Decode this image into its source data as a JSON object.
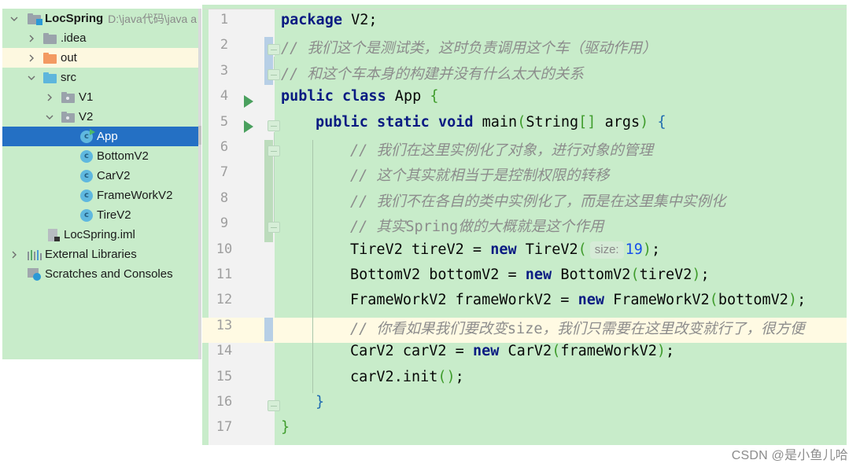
{
  "project_tree": {
    "root": {
      "name": "LocSpring",
      "path": "D:\\java代码\\java a"
    },
    "items": [
      {
        "label": ".idea",
        "type": "folder",
        "expanded": false
      },
      {
        "label": "out",
        "type": "folder-excluded",
        "expanded": false
      },
      {
        "label": "src",
        "type": "source-folder",
        "expanded": true
      },
      {
        "label": "V1",
        "type": "package",
        "expanded": false
      },
      {
        "label": "V2",
        "type": "package",
        "expanded": true
      },
      {
        "label": "App",
        "type": "class-runnable",
        "selected": true
      },
      {
        "label": "BottomV2",
        "type": "class"
      },
      {
        "label": "CarV2",
        "type": "class"
      },
      {
        "label": "FrameWorkV2",
        "type": "class"
      },
      {
        "label": "TireV2",
        "type": "class"
      },
      {
        "label": "LocSpring.iml",
        "type": "module-file"
      },
      {
        "label": "External Libraries",
        "type": "libraries",
        "expanded": false
      },
      {
        "label": "Scratches and Consoles",
        "type": "scratches"
      }
    ],
    "class_icon_letter": "c"
  },
  "editor": {
    "current_line": 13,
    "lines": [
      {
        "n": "1",
        "text": "package V2;"
      },
      {
        "n": "2",
        "text": "// 我们这个是测试类，这时负责调用这个车（驱动作用）"
      },
      {
        "n": "3",
        "text": "// 和这个车本身的构建并没有什么太大的关系"
      },
      {
        "n": "4",
        "text": "public class App {"
      },
      {
        "n": "5",
        "text": "public static void main(String[] args) {"
      },
      {
        "n": "6",
        "text": "// 我们在这里实例化了对象，进行对象的管理"
      },
      {
        "n": "7",
        "text": "// 这个其实就相当于是控制权限的转移"
      },
      {
        "n": "8",
        "text": "// 我们不在各自的类中实例化了，而是在这里集中实例化"
      },
      {
        "n": "9",
        "text": "// 其实Spring做的大概就是这个作用"
      },
      {
        "n": "10",
        "text": "TireV2 tireV2 = new TireV2( size: 19);"
      },
      {
        "n": "11",
        "text": "BottomV2 bottomV2 = new BottomV2(tireV2);"
      },
      {
        "n": "12",
        "text": "FrameWorkV2 frameWorkV2 = new FrameWorkV2(bottomV2);"
      },
      {
        "n": "13",
        "text": "// 你看如果我们要改变size，我们只需要在这里改变就行了，很方便"
      },
      {
        "n": "14",
        "text": "CarV2 carV2 = new CarV2(frameWorkV2);"
      },
      {
        "n": "15",
        "text": "carV2.init();"
      },
      {
        "n": "16",
        "text": "}"
      },
      {
        "n": "17",
        "text": "}"
      }
    ],
    "tokens": {
      "l1": {
        "kw": "package",
        "rest": " V2;"
      },
      "l2": {
        "slashes": "//",
        "body": " 我们这个是测试类，这时负责调用这个车（驱动作用）"
      },
      "l3": {
        "slashes": "//",
        "body": " 和这个车本身的构建并没有什么太大的关系"
      },
      "l4": {
        "kw1": "public",
        "kw2": "class",
        "name": " App ",
        "brace": "{"
      },
      "l5": {
        "kw1": "public",
        "kw2": "static",
        "kw3": "void",
        "name": " main",
        "lp": "(",
        "type": "String",
        "lb": "[]",
        "arg": " args",
        "rp": ")",
        "brace": "{"
      },
      "l6": {
        "slashes": "//",
        "body": " 我们在这里实例化了对象，进行对象的管理"
      },
      "l7": {
        "slashes": "//",
        "body": " 这个其实就相当于是控制权限的转移"
      },
      "l8": {
        "slashes": "//",
        "body": " 我们不在各自的类中实例化了，而是在这里集中实例化"
      },
      "l9": {
        "slashes": "//",
        "body1": " 其实",
        "mono": "Spring",
        "body2": "做的大概就是这个作用"
      },
      "l10": {
        "pre": "TireV2 tireV2 = ",
        "kw": "new",
        "call": " TireV2",
        "lp": "(",
        "hint": "size:",
        "num": "19",
        "rp": ")",
        "end": ";"
      },
      "l11": {
        "pre": "BottomV2 bottomV2 = ",
        "kw": "new",
        "call": " BottomV2",
        "lp": "(",
        "arg": "tireV2",
        "rp": ")",
        "end": ";"
      },
      "l12": {
        "pre": "FrameWorkV2 frameWorkV2 = ",
        "kw": "new",
        "call": " FrameWorkV2",
        "lp": "(",
        "arg": "bottomV2",
        "rp": ")",
        "end": ";"
      },
      "l13": {
        "slashes": "//",
        "body1": " 你看如果我们要改变",
        "mono": "size",
        "body2": "，我们只需要在这里改变就行了，很方便"
      },
      "l14": {
        "pre": "CarV2 carV2 = ",
        "kw": "new",
        "call": " CarV2",
        "lp": "(",
        "arg": "frameWorkV2",
        "rp": ")",
        "end": ";"
      },
      "l15": {
        "pre": "carV2.init",
        "lp": "(",
        "rp": ")",
        "end": ";"
      },
      "l16": {
        "brace": "}"
      },
      "l17": {
        "brace": "}"
      }
    },
    "run_gutter_lines": [
      4,
      5
    ]
  },
  "watermark": "CSDN @是小鱼儿哈"
}
